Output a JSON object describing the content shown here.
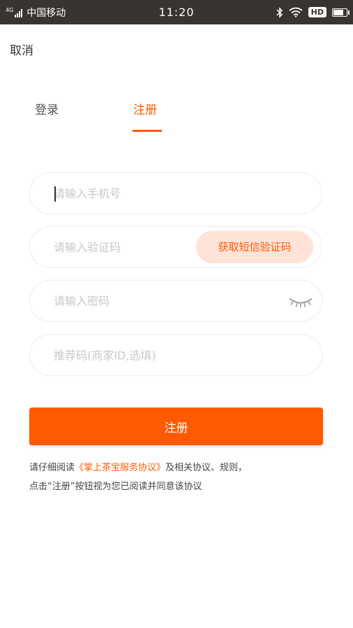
{
  "status_bar": {
    "network": "4G",
    "carrier": "中国移动",
    "time": "11:20",
    "hd": "HD"
  },
  "header": {
    "cancel_label": "取消"
  },
  "tabs": [
    {
      "label": "登录",
      "active": false
    },
    {
      "label": "注册",
      "active": true
    }
  ],
  "form": {
    "phone_placeholder": "请输入手机号",
    "code_placeholder": "请输入验证码",
    "sms_button_label": "获取短信验证码",
    "password_placeholder": "请输入密码",
    "referral_placeholder": "推荐码(商家ID,选填)",
    "submit_label": "注册"
  },
  "agreement": {
    "prefix": "请仔细阅读",
    "link": "《掌上茶宝服务协议》",
    "suffix": "及相关协议、规则，",
    "line2": "点击“注册”按钮视为您已阅读并同意该协议"
  },
  "colors": {
    "accent": "#ff5a00",
    "sms_button_bg": "#ffe3d8",
    "status_bar_bg": "#3a3431"
  }
}
